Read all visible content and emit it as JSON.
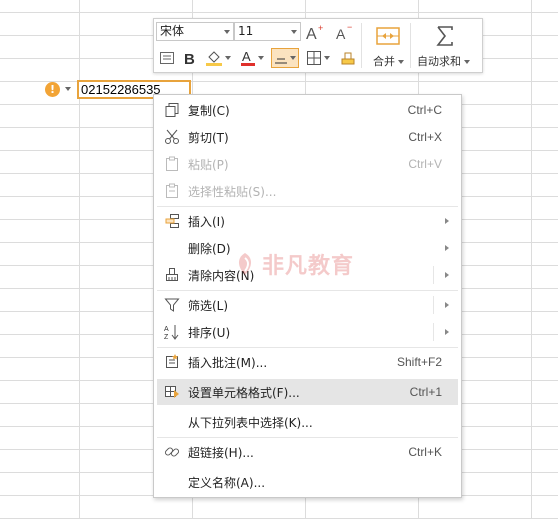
{
  "cell": {
    "value": "02152286535"
  },
  "toolbar": {
    "font_name": "宋体",
    "font_size": "11",
    "merge_label": "合并",
    "autosum_label": "自动求和",
    "colors": {
      "font": "#e0302b",
      "fill": "#f7c948",
      "accent": "#e8a33c"
    }
  },
  "menu": {
    "items": [
      {
        "icon": "copy-icon",
        "label": "复制(C)",
        "shortcut": "Ctrl+C"
      },
      {
        "icon": "cut-icon",
        "label": "剪切(T)",
        "shortcut": "Ctrl+X"
      },
      {
        "icon": "paste-icon",
        "label": "粘贴(P)",
        "shortcut": "Ctrl+V"
      },
      {
        "icon": "paste-special-icon",
        "label": "选择性粘贴(S)..."
      },
      {
        "icon": "insert-icon",
        "label": "插入(I)"
      },
      {
        "label": "删除(D)"
      },
      {
        "icon": "clear-icon",
        "label": "清除内容(N)"
      },
      {
        "icon": "filter-icon",
        "label": "筛选(L)"
      },
      {
        "icon": "sort-icon",
        "label": "排序(U)"
      },
      {
        "icon": "comment-icon",
        "label": "插入批注(M)...",
        "shortcut": "Shift+F2"
      },
      {
        "icon": "format-cells-icon",
        "label": "设置单元格格式(F)...",
        "shortcut": "Ctrl+1"
      },
      {
        "label": "从下拉列表中选择(K)..."
      },
      {
        "icon": "hyperlink-icon",
        "label": "超链接(H)...",
        "shortcut": "Ctrl+K"
      },
      {
        "label": "定义名称(A)..."
      }
    ]
  },
  "watermark": {
    "text": "非凡教育"
  }
}
